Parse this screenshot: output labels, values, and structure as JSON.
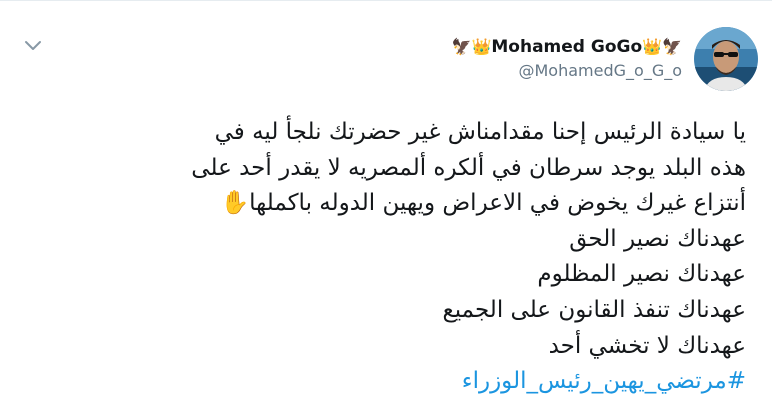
{
  "tweet": {
    "author": {
      "display_name": "Mohamed GoGo",
      "handle": "@MohamedG_o_G_o",
      "name_prefix_emoji": [
        "🦅",
        "👑"
      ],
      "name_suffix_emoji": [
        "👑",
        "🦅"
      ],
      "avatar_icon": "profile-photo"
    },
    "menu_icon": "chevron-down-icon",
    "lines": [
      "يا سيادة الرئيس إحنا مقدامناش غير حضرتك نلجأ ليه في",
      "هذه البلد يوجد سرطان في ألكره ألمصريه لا يقدر أحد على",
      "أنتزاع غيرك يخوض في الاعراض ويهين الدوله باكملها✋",
      "عهدناك نصير الحق",
      "عهدناك نصير المظلوم",
      "عهدناك تنفذ القانون على الجميع",
      "عهدناك لا تخشي أحد"
    ],
    "hashtag": "#مرتضي_يهين_رئيس_الوزراء",
    "colors": {
      "text": "#14171a",
      "secondary": "#657786",
      "link": "#1b95e0",
      "border": "#e6ecf0"
    }
  }
}
